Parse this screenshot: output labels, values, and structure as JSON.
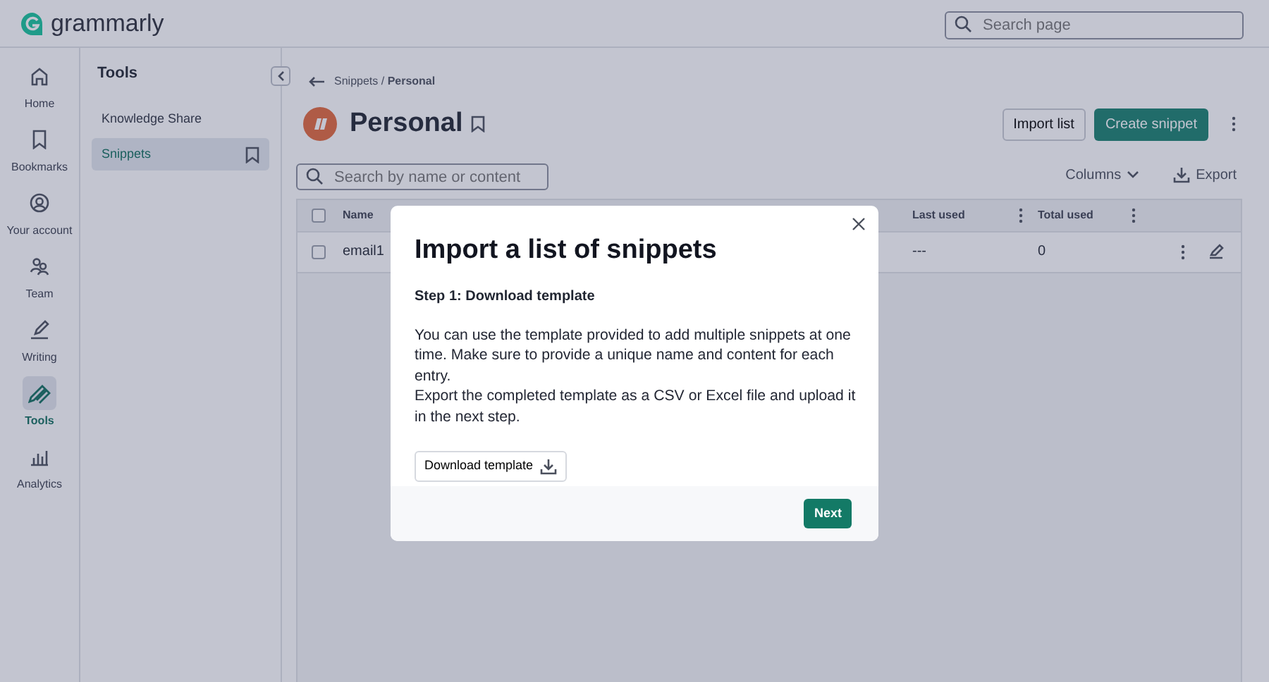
{
  "top_bar": {
    "logo": "grammarly",
    "search": {
      "placeholder": "Search page"
    }
  },
  "nav_rail": [
    {
      "label": "Home",
      "selected": false
    },
    {
      "label": "Bookmarks",
      "selected": false
    },
    {
      "label": "Your account",
      "selected": false
    },
    {
      "label": "Team",
      "selected": false
    },
    {
      "label": "Writing",
      "selected": false
    },
    {
      "label": "Tools",
      "selected": true
    },
    {
      "label": "Analytics",
      "selected": false
    }
  ],
  "tools_panel": {
    "title": "Tools",
    "items": [
      {
        "label": "Knowledge Share",
        "selected": false
      },
      {
        "label": "Snippets",
        "selected": true
      }
    ]
  },
  "breadcrumb": {
    "items": [
      "Snippets",
      "Personal"
    ],
    "separator": "/"
  },
  "page_title": "Personal",
  "actions": [
    "Import list",
    "Create snippet"
  ],
  "table_search": {
    "placeholder": "Search by name or content"
  },
  "columns_button": "Columns",
  "export_button": "Export",
  "table": {
    "all_checked": false,
    "columns": [
      "Name",
      "Last used",
      "Total used"
    ],
    "rows": [
      {
        "checked": false,
        "cells": [
          "email1",
          "---",
          "0"
        ]
      }
    ]
  },
  "modal": {
    "title": "Import a list of snippets",
    "step": "Step 1: Download template",
    "paragraphs": [
      "You can use the template provided to add multiple snippets at one time. Make sure to provide a unique name and content for each entry.",
      "Export the completed template as a CSV or Excel file and upload it in the next step."
    ],
    "download_button": "Download template",
    "next_button": "Next"
  }
}
